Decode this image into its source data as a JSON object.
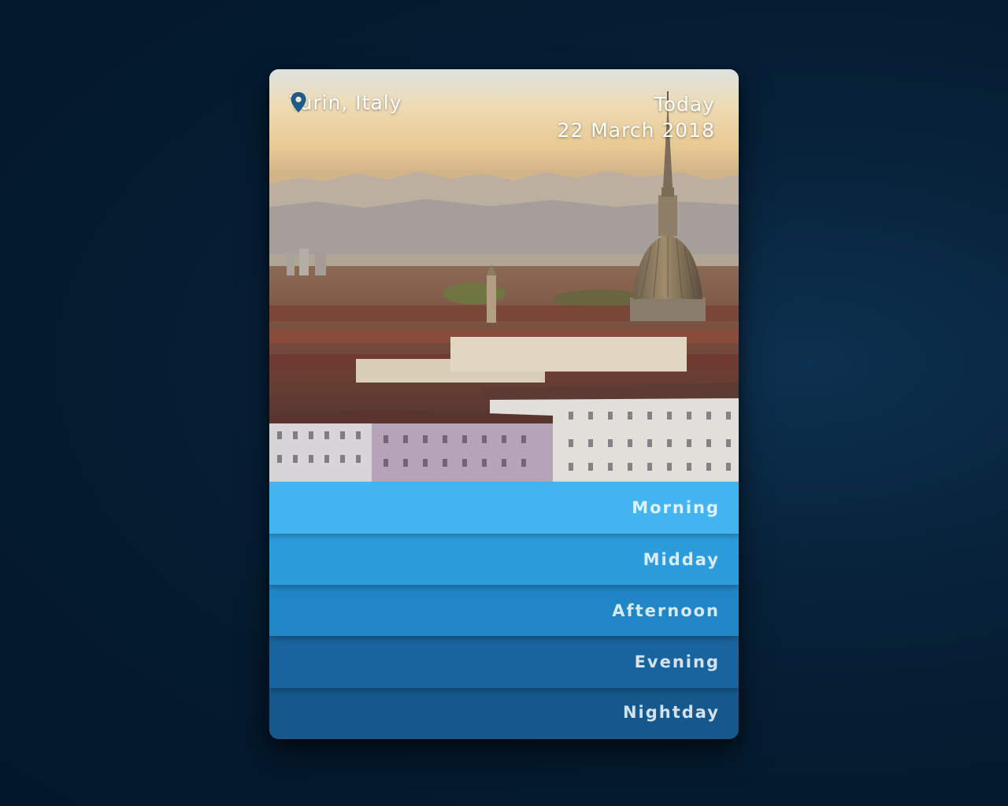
{
  "location": {
    "icon": "map-pin-icon",
    "text": "Turin, Italy"
  },
  "date": {
    "label": "Today",
    "value": "22 March 2018"
  },
  "periods": [
    {
      "label": "Morning",
      "color": "#42b4f0"
    },
    {
      "label": "Midday",
      "color": "#2c9cdb"
    },
    {
      "label": "Afternoon",
      "color": "#2186c6"
    },
    {
      "label": "Evening",
      "color": "#19649f"
    },
    {
      "label": "Nightday",
      "color": "#15588c"
    }
  ],
  "colors": {
    "pin": "#1e5a8c",
    "background": "#041a2e"
  }
}
